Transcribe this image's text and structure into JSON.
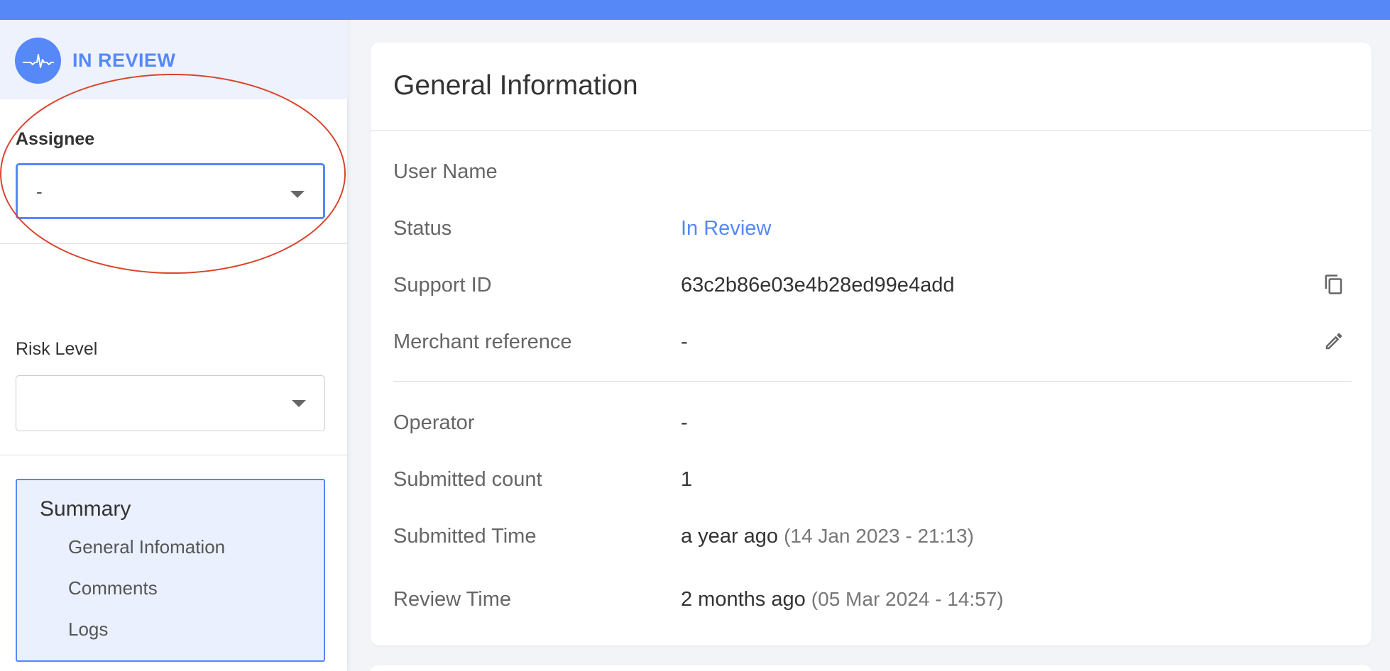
{
  "sidebar": {
    "status_label": "IN REVIEW",
    "status_icon": "heartbeat-icon",
    "assignee": {
      "label": "Assignee",
      "value": "-"
    },
    "risk_level": {
      "label": "Risk Level",
      "value": ""
    },
    "summary": {
      "title": "Summary",
      "items": [
        "General Infomation",
        "Comments",
        "Logs"
      ]
    }
  },
  "main": {
    "title": "General Information",
    "rows": [
      {
        "label": "User Name",
        "value": ""
      },
      {
        "label": "Status",
        "value": "In Review"
      },
      {
        "label": "Support ID",
        "value": "63c2b86e03e4b28ed99e4add",
        "icon": "copy-icon"
      },
      {
        "label": "Merchant reference",
        "value": "-",
        "icon": "edit-pencil-icon"
      },
      {
        "label": "Operator",
        "value": "-"
      },
      {
        "label": "Submitted count",
        "value": "1"
      },
      {
        "label": "Submitted Time",
        "value": "a year ago",
        "sub": "(14 Jan 2023 - 21:13)"
      },
      {
        "label": "Review Time",
        "value": "2 months ago",
        "sub": "(05 Mar 2024 - 14:57)"
      }
    ]
  },
  "colors": {
    "accent": "#5688f7",
    "annotation": "#d9432c",
    "summary_bg": "#eaf0fd"
  }
}
